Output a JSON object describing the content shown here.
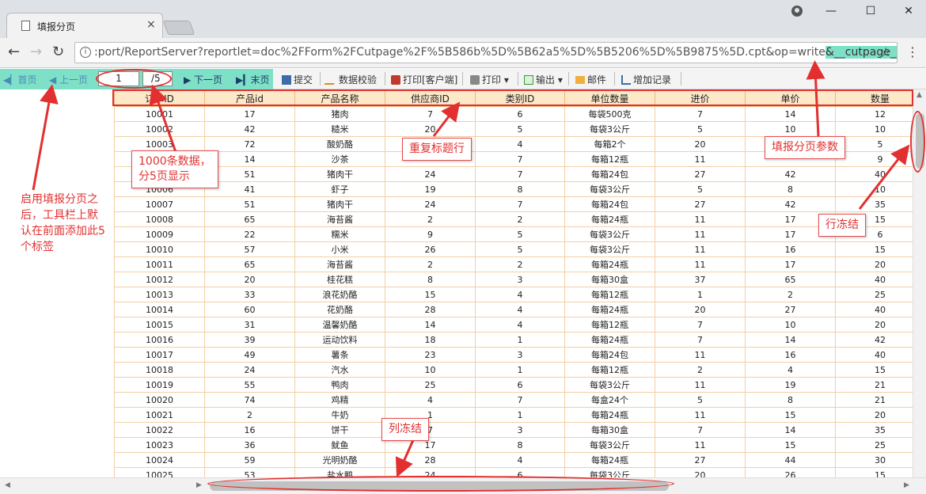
{
  "browser": {
    "tab_title": "填报分页",
    "tab_close": "×",
    "url_main": ":port/ReportServer?reportlet=doc%2FForm%2FCutpage%2F%5B586b%5D%5B62a5%5D%5B5206%5D%5B9875%5D.cpt&op=write",
    "url_highlight": "&__cutpage__=v",
    "info_icon": "i",
    "back_glyph": "←",
    "forward_glyph": "→",
    "reload_glyph": "↻",
    "star_glyph": "☆",
    "menu_glyph": "⋮",
    "min_glyph": "—",
    "max_glyph": "☐",
    "close_glyph": "✕"
  },
  "toolbar": {
    "first": "首页",
    "prev": "上一页",
    "page_current": "1",
    "page_total": "/5",
    "next": "下一页",
    "last": "末页",
    "submit": "提交",
    "verify": "数据校验",
    "print_client": "打印[客户端]",
    "print": "打印",
    "export": "输出",
    "email": "邮件",
    "add_record": "增加记录"
  },
  "table": {
    "headers": [
      "订单ID",
      "产品id",
      "产品名称",
      "供应商ID",
      "类别ID",
      "单位数量",
      "进价",
      "单价",
      "数量"
    ],
    "rows": [
      [
        "10001",
        "17",
        "猪肉",
        "7",
        "6",
        "每袋500克",
        "7",
        "14",
        "12"
      ],
      [
        "10002",
        "42",
        "糙米",
        "20",
        "5",
        "每袋3公斤",
        "5",
        "10",
        "10"
      ],
      [
        "10003",
        "72",
        "酸奶酪",
        "",
        "4",
        "每箱2个",
        "20",
        "",
        "5"
      ],
      [
        "10004",
        "14",
        "沙茶",
        "",
        "7",
        "每箱12瓶",
        "11",
        "",
        "9"
      ],
      [
        "10005",
        "51",
        "猪肉干",
        "24",
        "7",
        "每箱24包",
        "27",
        "42",
        "40"
      ],
      [
        "10006",
        "41",
        "虾子",
        "19",
        "8",
        "每袋3公斤",
        "5",
        "8",
        "10"
      ],
      [
        "10007",
        "51",
        "猪肉干",
        "24",
        "7",
        "每箱24包",
        "27",
        "42",
        "35"
      ],
      [
        "10008",
        "65",
        "海苔酱",
        "2",
        "2",
        "每箱24瓶",
        "11",
        "17",
        "15"
      ],
      [
        "10009",
        "22",
        "糯米",
        "9",
        "5",
        "每袋3公斤",
        "11",
        "17",
        "6"
      ],
      [
        "10010",
        "57",
        "小米",
        "26",
        "5",
        "每袋3公斤",
        "11",
        "16",
        "15"
      ],
      [
        "10011",
        "65",
        "海苔酱",
        "2",
        "2",
        "每箱24瓶",
        "11",
        "17",
        "20"
      ],
      [
        "10012",
        "20",
        "桂花糕",
        "8",
        "3",
        "每箱30盒",
        "37",
        "65",
        "40"
      ],
      [
        "10013",
        "33",
        "浪花奶酪",
        "15",
        "4",
        "每箱12瓶",
        "1",
        "2",
        "25"
      ],
      [
        "10014",
        "60",
        "花奶酪",
        "28",
        "4",
        "每箱24瓶",
        "20",
        "27",
        "40"
      ],
      [
        "10015",
        "31",
        "温馨奶酪",
        "14",
        "4",
        "每箱12瓶",
        "7",
        "10",
        "20"
      ],
      [
        "10016",
        "39",
        "运动饮料",
        "18",
        "1",
        "每箱24瓶",
        "7",
        "14",
        "42"
      ],
      [
        "10017",
        "49",
        "薯条",
        "23",
        "3",
        "每箱24包",
        "11",
        "16",
        "40"
      ],
      [
        "10018",
        "24",
        "汽水",
        "10",
        "1",
        "每箱12瓶",
        "2",
        "4",
        "15"
      ],
      [
        "10019",
        "55",
        "鸭肉",
        "25",
        "6",
        "每袋3公斤",
        "11",
        "19",
        "21"
      ],
      [
        "10020",
        "74",
        "鸡精",
        "4",
        "7",
        "每盒24个",
        "5",
        "8",
        "21"
      ],
      [
        "10021",
        "2",
        "牛奶",
        "1",
        "1",
        "每箱24瓶",
        "11",
        "15",
        "20"
      ],
      [
        "10022",
        "16",
        "饼干",
        "7",
        "3",
        "每箱30盒",
        "7",
        "14",
        "35"
      ],
      [
        "10023",
        "36",
        "鱿鱼",
        "17",
        "8",
        "每袋3公斤",
        "11",
        "15",
        "25"
      ],
      [
        "10024",
        "59",
        "光明奶酪",
        "28",
        "4",
        "每箱24瓶",
        "27",
        "44",
        "30"
      ],
      [
        "10025",
        "53",
        "盐水鸭",
        "24",
        "6",
        "每袋3公斤",
        "20",
        "26",
        "15"
      ]
    ]
  },
  "annotations": {
    "toolbar_note": "启用填报分页之后，工具栏上默认在前面添加此5个标签",
    "data_note_1": "1000条数据，",
    "data_note_2": "分5页显示",
    "header_note": "重复标题行",
    "param_note": "填报分页参数",
    "row_freeze_note": "行冻结",
    "col_freeze_note": "列冻结"
  },
  "colors": {
    "pager_bg": "#7fe0c8",
    "annotation": "#e23030",
    "header_bg": "#fde8c8"
  }
}
